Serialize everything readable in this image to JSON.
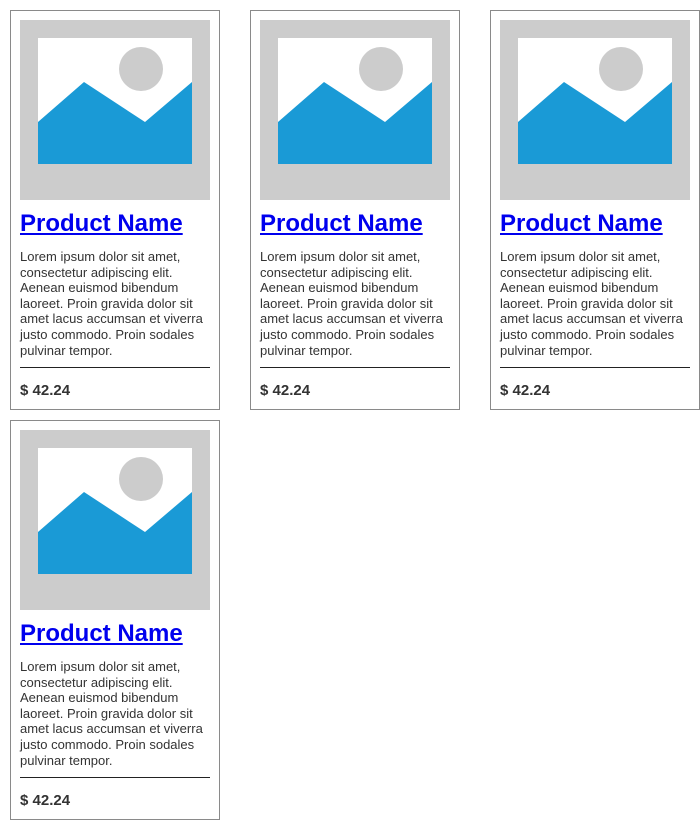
{
  "colors": {
    "placeholder_frame": "#cccccc",
    "mountain": "#1a9ad6",
    "sun": "#cccccc",
    "link": "#0000ee",
    "text": "#333333"
  },
  "products": [
    {
      "image_icon": "image-placeholder-icon",
      "name": "Product Name",
      "description": "Lorem ipsum dolor sit amet, consectetur adipiscing elit. Aenean euismod bibendum laoreet. Proin gravida dolor sit amet lacus accumsan et viverra justo commodo. Proin sodales pulvinar tempor.",
      "price": "$ 42.24"
    },
    {
      "image_icon": "image-placeholder-icon",
      "name": "Product Name",
      "description": "Lorem ipsum dolor sit amet, consectetur adipiscing elit. Aenean euismod bibendum laoreet. Proin gravida dolor sit amet lacus accumsan et viverra justo commodo. Proin sodales pulvinar tempor.",
      "price": "$ 42.24"
    },
    {
      "image_icon": "image-placeholder-icon",
      "name": "Product Name",
      "description": "Lorem ipsum dolor sit amet, consectetur adipiscing elit. Aenean euismod bibendum laoreet. Proin gravida dolor sit amet lacus accumsan et viverra justo commodo. Proin sodales pulvinar tempor.",
      "price": "$ 42.24"
    },
    {
      "image_icon": "image-placeholder-icon",
      "name": "Product Name",
      "description": "Lorem ipsum dolor sit amet, consectetur adipiscing elit. Aenean euismod bibendum laoreet. Proin gravida dolor sit amet lacus accumsan et viverra justo commodo. Proin sodales pulvinar tempor.",
      "price": "$ 42.24"
    }
  ]
}
